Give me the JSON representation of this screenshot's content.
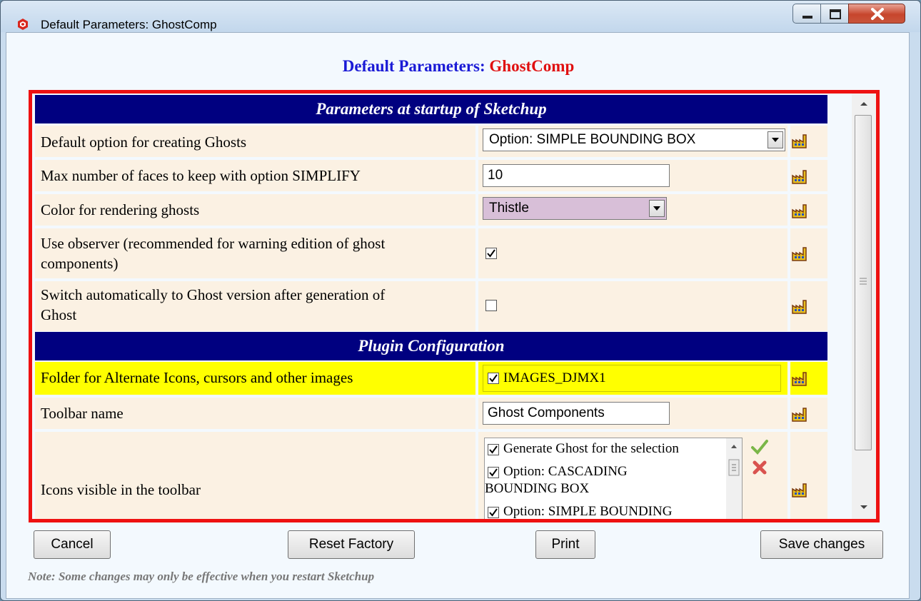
{
  "window": {
    "title": "Default Parameters: GhostComp"
  },
  "heading": {
    "prefix": "Default Parameters:",
    "name": "GhostComp"
  },
  "sections": {
    "startup": "Parameters at startup of Sketchup",
    "plugin": "Plugin Configuration"
  },
  "params": {
    "default_option": {
      "label": "Default option for creating Ghosts",
      "value": "Option: SIMPLE BOUNDING BOX"
    },
    "max_faces": {
      "label": "Max number of faces to keep with option SIMPLIFY",
      "value": "10"
    },
    "color": {
      "label": "Color for rendering ghosts",
      "value": "Thistle",
      "swatch": "#d8bfd8"
    },
    "observer": {
      "label_line1": "Use observer (recommended for warning edition of ghost",
      "label_line2": "components)",
      "checked": true
    },
    "switch": {
      "label_line1": "Switch automatically to Ghost version after generation of",
      "label_line2": "Ghost",
      "checked": false
    },
    "images_folder": {
      "label": "Folder for Alternate Icons, cursors and other images",
      "value": "IMAGES_DJMX1",
      "checked": true
    },
    "toolbar_name": {
      "label": "Toolbar name",
      "value": "Ghost Components"
    },
    "icons_visible": {
      "label": "Icons visible in the toolbar",
      "items": [
        {
          "line1": "Generate Ghost for the selection",
          "line2": "",
          "checked": true
        },
        {
          "line1": "Option: CASCADING",
          "line2": "BOUNDING BOX",
          "checked": true
        },
        {
          "line1": "Option: SIMPLE BOUNDING",
          "line2": "",
          "checked": true
        }
      ]
    }
  },
  "buttons": {
    "cancel": "Cancel",
    "reset": "Reset Factory",
    "print": "Print",
    "save": "Save changes"
  },
  "note": "Note: Some changes may only be effective when you restart Sketchup",
  "colors": {
    "header_bg": "#000080",
    "frame_border": "#ee1111",
    "highlight": "#ffff00",
    "row_bg": "#fbf1e3"
  }
}
